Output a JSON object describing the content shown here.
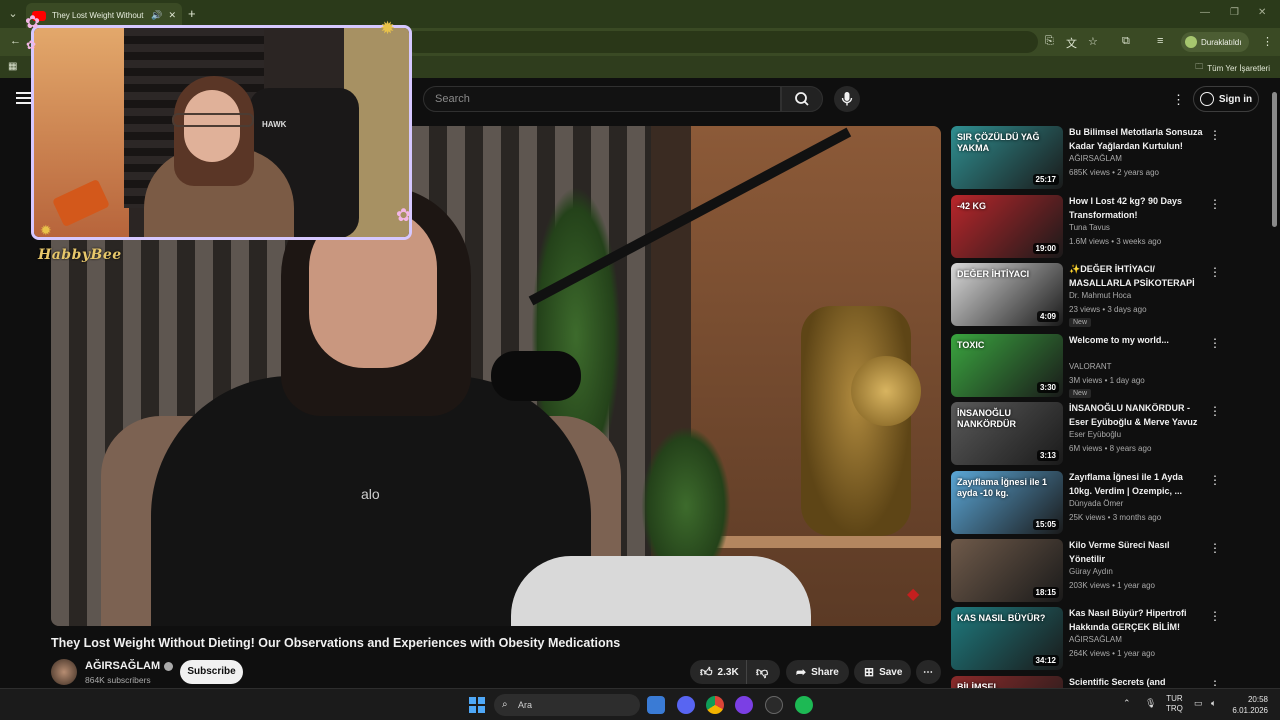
{
  "browser": {
    "tab_title": "They Lost Weight Without Dieting",
    "tab_dropdown_icon": "chevron-down-icon",
    "tab_audio_icon": "speaker-icon",
    "tab_close": "✕",
    "new_tab": "+",
    "window_controls": [
      "—",
      "❐",
      "✕"
    ],
    "profile_label": "Duraklatıldı",
    "bookmarks_all": "Tüm Yer İşaretleri"
  },
  "youtube": {
    "search_placeholder": "Search",
    "sign_in": "Sign in",
    "video": {
      "title": "They Lost Weight Without Dieting! Our Observations and Experiences with Obesity Medications",
      "channel": "AĞIRSAĞLAM",
      "subscribers": "864K subscribers",
      "subscribe_label": "Subscribe",
      "likes": "2.3K",
      "share_label": "Share",
      "save_label": "Save",
      "scene_text": "alo",
      "webcam_chair_text": "HAWK"
    },
    "overlay": {
      "streamer_name": "HabbyBee"
    },
    "recommendations": [
      {
        "title": "Bu Bilimsel Metotlarla Sonsuza Kadar Yağlardan Kurtulun!",
        "channel": "AĞIRSAĞLAM",
        "meta": "685K views • 2 years ago",
        "duration": "25:17",
        "thumb_text": "SIR ÇÖZÜLDÜ YAĞ YAKMA",
        "thumb_color": "#2f8f91",
        "new": ""
      },
      {
        "title": "How I Lost 42 kg? 90 Days Transformation!",
        "channel": "Tuna Tavus",
        "meta": "1.6M views • 3 weeks ago",
        "duration": "19:00",
        "thumb_text": "-42 KG",
        "thumb_color": "#b9262b",
        "new": ""
      },
      {
        "title": "✨DEĞER İHTİYACI/ MASALLARLA PSİKOTERAPİ",
        "channel": "Dr. Mahmut Hoca",
        "meta": "23 views • 3 days ago",
        "duration": "4:09",
        "thumb_text": "DEĞER İHTİYACI",
        "thumb_color": "#d9d9d9",
        "new": "New"
      },
      {
        "title": "Welcome to my world...",
        "channel": "VALORANT",
        "meta": "3M views • 1 day ago",
        "duration": "3:30",
        "thumb_text": "TOXIC",
        "thumb_color": "#3aa53f",
        "new": "New"
      },
      {
        "title": "İNSANOĞLU NANKÖRDUR - Eser Eyüboğlu & Merve Yavuz",
        "channel": "Eser Eyüboğlu",
        "meta": "6M views • 8 years ago",
        "duration": "3:13",
        "thumb_text": "İNSANOĞLU NANKÖRDÜR",
        "thumb_color": "#5a5a5a",
        "new": ""
      },
      {
        "title": "Zayıflama İğnesi ile 1 Ayda 10kg. Verdim | Ozempic, ...",
        "channel": "Dünyada Ömer",
        "meta": "25K views • 3 months ago",
        "duration": "15:05",
        "thumb_text": "Zayıflama İğnesi ile 1 ayda -10 kg.",
        "thumb_color": "#5aa6d6",
        "new": ""
      },
      {
        "title": "Kilo Verme Süreci Nasıl Yönetilir",
        "channel": "Güray Aydın",
        "meta": "203K views • 1 year ago",
        "duration": "18:15",
        "thumb_text": "",
        "thumb_color": "#6f5a4a",
        "new": ""
      },
      {
        "title": "Kas Nasıl Büyür? Hipertrofi Hakkında GERÇEK BİLİM!",
        "channel": "AĞIRSAĞLAM",
        "meta": "264K views • 1 year ago",
        "duration": "34:12",
        "thumb_text": "KAS NASIL BÜYÜR?",
        "thumb_color": "#1e7a7e",
        "new": ""
      },
      {
        "title": "Scientific Secrets (and",
        "channel": "",
        "meta": "",
        "duration": "",
        "thumb_text": "BİLİMSEL",
        "thumb_color": "#8a2a2a",
        "new": ""
      }
    ]
  },
  "taskbar": {
    "search_placeholder": "Ara",
    "lang_top": "TUR",
    "lang_bottom": "TRQ",
    "time": "20:58",
    "date": "6.01.2026"
  },
  "colors": {
    "accent": "#ff0000",
    "browser_theme": "#3a4a24"
  }
}
